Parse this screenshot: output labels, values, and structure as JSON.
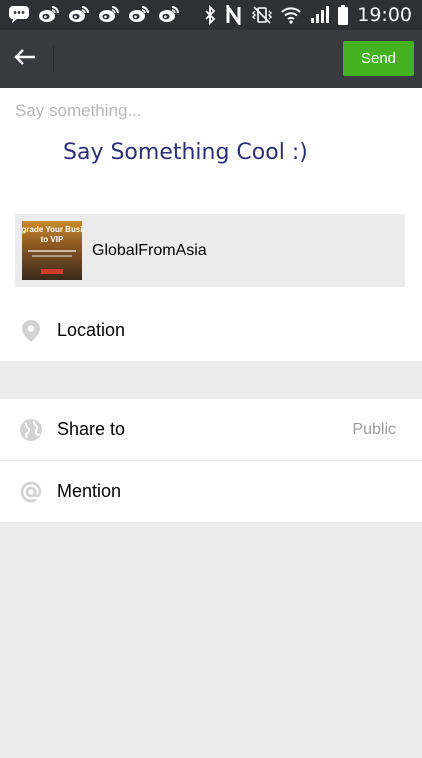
{
  "status_bar": {
    "time": "19:00",
    "left_icons": [
      "chat-notification-icon",
      "weibo-icon",
      "weibo-icon",
      "weibo-icon",
      "weibo-icon",
      "weibo-icon"
    ],
    "right_icons": [
      "bluetooth-icon",
      "nfc-icon",
      "vibrate-icon",
      "wifi-icon",
      "signal-icon",
      "battery-icon"
    ]
  },
  "action_bar": {
    "back_icon": "arrow-left-icon",
    "send_label": "Send",
    "send_color": "#45b020"
  },
  "compose": {
    "placeholder": "Say something...",
    "overlay_caption": "Say Something Cool :)",
    "link_card": {
      "thumbnail_line1": "grade Your Busi",
      "thumbnail_line2": "to VIP",
      "title": "GlobalFromAsia"
    },
    "location": {
      "icon": "location-pin-icon",
      "label": "Location"
    }
  },
  "options": {
    "share_to": {
      "icon": "globe-icon",
      "label": "Share to",
      "value": "Public"
    },
    "mention": {
      "icon": "at-sign-icon",
      "label": "Mention"
    }
  }
}
